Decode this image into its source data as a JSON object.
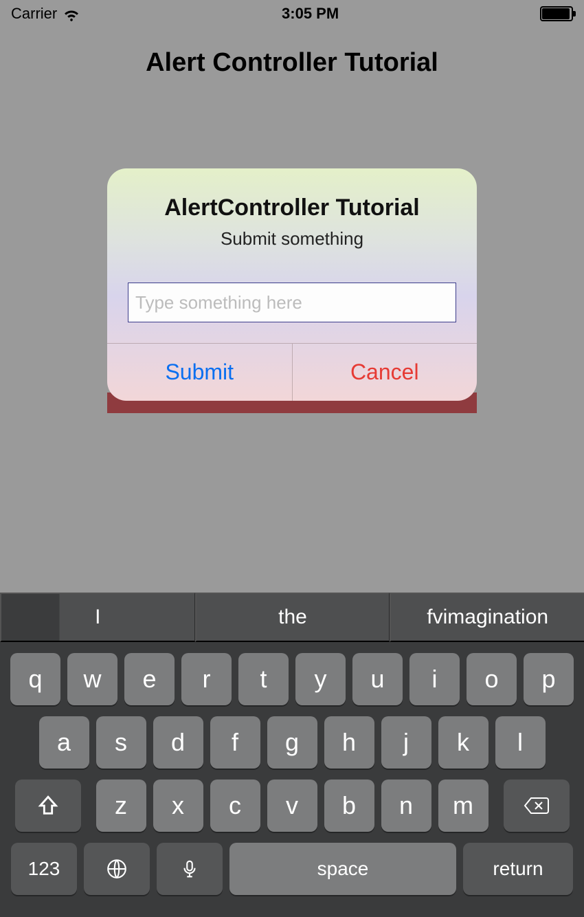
{
  "status_bar": {
    "carrier": "Carrier",
    "time": "3:05 PM"
  },
  "page": {
    "title": "Alert Controller Tutorial"
  },
  "alert": {
    "title": "AlertController Tutorial",
    "subtitle": "Submit something",
    "input_placeholder": "Type something here",
    "input_value": "",
    "submit_label": "Submit",
    "cancel_label": "Cancel"
  },
  "keyboard": {
    "predictions": [
      "I",
      "the",
      "fvimagination"
    ],
    "row1": [
      "q",
      "w",
      "e",
      "r",
      "t",
      "y",
      "u",
      "i",
      "o",
      "p"
    ],
    "row2": [
      "a",
      "s",
      "d",
      "f",
      "g",
      "h",
      "j",
      "k",
      "l"
    ],
    "row3": [
      "z",
      "x",
      "c",
      "v",
      "b",
      "n",
      "m"
    ],
    "numbers_label": "123",
    "space_label": "space",
    "return_label": "return"
  }
}
